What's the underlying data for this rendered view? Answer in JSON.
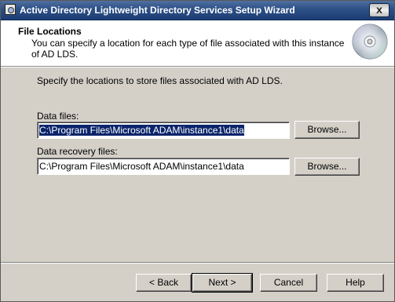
{
  "window": {
    "title": "Active Directory Lightweight Directory Services Setup Wizard",
    "close_label": "x"
  },
  "header": {
    "title": "File Locations",
    "description": "You can specify a location for each type of file associated with this instance of AD LDS."
  },
  "main": {
    "intro": "Specify the locations to store files associated with AD LDS.",
    "data_files": {
      "label": "Data files:",
      "value": "C:\\Program Files\\Microsoft ADAM\\instance1\\data",
      "browse_label": "Browse..."
    },
    "recovery_files": {
      "label": "Data recovery files:",
      "value": "C:\\Program Files\\Microsoft ADAM\\instance1\\data",
      "browse_label": "Browse..."
    }
  },
  "footer": {
    "back_label": "< Back",
    "next_label": "Next >",
    "cancel_label": "Cancel",
    "help_label": "Help"
  },
  "icons": {
    "title_icon": "setup-app-icon",
    "header_icon": "cd-disc-icon"
  },
  "colors": {
    "titlebar": "#2c4f86",
    "selection": "#0a246a",
    "dialog_bg": "#d4d0c8"
  }
}
